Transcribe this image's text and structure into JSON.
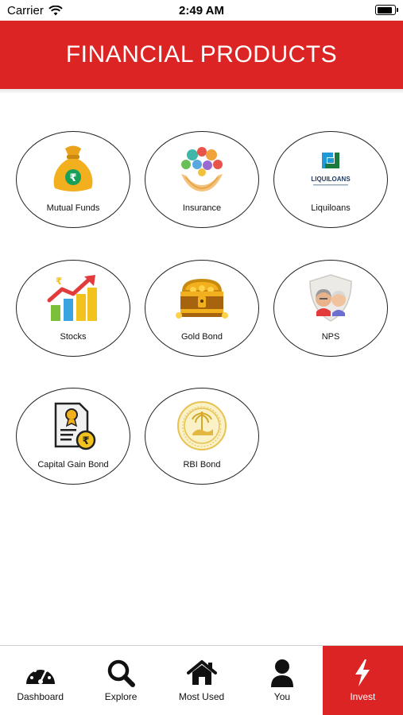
{
  "status_bar": {
    "carrier": "Carrier",
    "time": "2:49 AM",
    "battery_level": 0.9
  },
  "header": {
    "title": "FINANCIAL PRODUCTS"
  },
  "products": [
    {
      "label": "Mutual Funds",
      "icon": "money-bag-icon"
    },
    {
      "label": "Insurance",
      "icon": "insurance-icon"
    },
    {
      "label": "Liquiloans",
      "icon": "liquiloans-logo",
      "logo_text": "LIQUILOANS"
    },
    {
      "label": "Stocks",
      "icon": "stocks-growth-icon"
    },
    {
      "label": "Gold Bond",
      "icon": "treasure-chest-icon"
    },
    {
      "label": "NPS",
      "icon": "elderly-couple-shield-icon"
    },
    {
      "label": "Capital Gain Bond",
      "icon": "certificate-icon"
    },
    {
      "label": "RBI Bond",
      "icon": "rbi-seal-icon"
    }
  ],
  "tabs": [
    {
      "label": "Dashboard",
      "icon": "speedometer-icon",
      "active": false
    },
    {
      "label": "Explore",
      "icon": "search-icon",
      "active": false
    },
    {
      "label": "Most Used",
      "icon": "home-icon",
      "active": false
    },
    {
      "label": "You",
      "icon": "user-icon",
      "active": false
    },
    {
      "label": "Invest",
      "icon": "bolt-icon",
      "active": true
    }
  ],
  "colors": {
    "brand_red": "#dc2424",
    "gold": "#f2b01e",
    "border": "#222222"
  }
}
